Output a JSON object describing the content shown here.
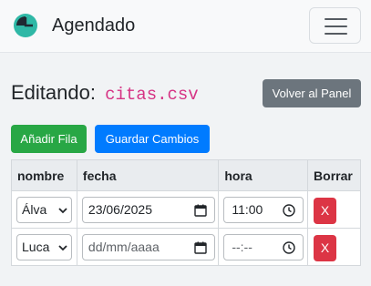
{
  "navbar": {
    "brand": "Agendado",
    "logo_icon": "clock-icon",
    "menu_icon": "hamburger-menu-icon"
  },
  "editor": {
    "title_prefix": "Editando:",
    "filename": "citas.csv",
    "back_label": "Volver al Panel",
    "add_row_label": "Añadir Fila",
    "save_label": "Guardar Cambios"
  },
  "table": {
    "headers": [
      "nombre",
      "fecha",
      "hora",
      "Borrar"
    ],
    "rows": [
      {
        "nombre": "Álva",
        "fecha": "23/06/2025",
        "hora": "11:00",
        "delete_label": "X"
      },
      {
        "nombre": "Luca",
        "fecha": "dd/mm/aaaa",
        "hora": "--:--",
        "delete_label": "X"
      }
    ]
  },
  "colors": {
    "success": "#28a745",
    "primary": "#007bff",
    "secondary": "#6c757d",
    "danger": "#dc3545",
    "code": "#d63384",
    "logo": "#2fb8a6"
  }
}
